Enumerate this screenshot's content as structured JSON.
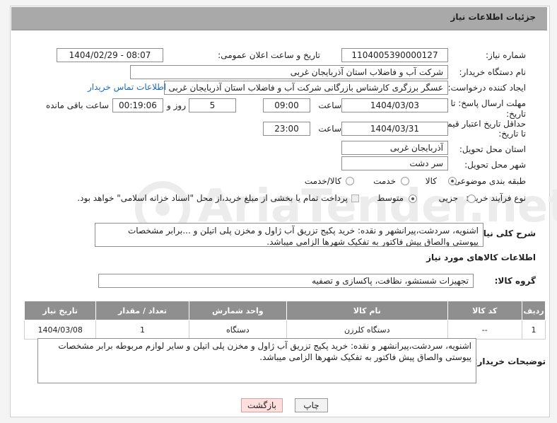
{
  "header": {
    "title": "جزئیات اطلاعات نیاز"
  },
  "watermark": "AriaTender.net",
  "fields": {
    "need_number": {
      "label": "شماره نیاز:",
      "value": "1104005390000127"
    },
    "announce_datetime": {
      "label": "تاریخ و ساعت اعلان عمومی:",
      "value": "1404/02/29 - 08:07"
    },
    "buyer_org": {
      "label": "نام دستگاه خریدار:",
      "value": "شرکت آب و فاضلاب استان آذربایجان غربی"
    },
    "requester": {
      "label": "ایجاد کننده درخواست:",
      "value": "عسگر  برزگری کارشناس بازرگانی شرکت آب و فاضلاب استان آذربایجان غربی",
      "contact_link": "اطلاعات تماس خریدار"
    },
    "send_deadline": {
      "label_line1": "مهلت ارسال پاسخ: تا",
      "label_line2": "تاریخ:",
      "date": "1404/03/03",
      "time_label": "ساعت",
      "time": "09:00",
      "days": "5",
      "days_label": "روز و",
      "remaining": "00:19:06",
      "remaining_label": "ساعت باقی مانده"
    },
    "price_validity": {
      "label_line1": "حداقل تاریخ اعتبار قیمت:",
      "label_line2": "تا تاریخ:",
      "date": "1404/03/31",
      "time_label": "ساعت",
      "time": "23:00"
    },
    "delivery_province": {
      "label": "استان محل تحویل:",
      "value": "آذربایجان غربی"
    },
    "delivery_city": {
      "label": "شهر محل تحویل:",
      "value": "سر دشت"
    },
    "category": {
      "label": "طبقه بندی موضوعی:",
      "options": [
        "کالا",
        "خدمت",
        "کالا/خدمت"
      ],
      "selected": "کالا"
    },
    "process_type": {
      "label": "نوع فرآیند خرید :",
      "options": [
        "جزیی",
        "متوسط"
      ],
      "selected": "متوسط",
      "payment_note": "پرداخت تمام یا بخشی از مبلغ خرید،از محل \"اسناد خزانه اسلامی\" خواهد بود."
    }
  },
  "general_desc": {
    "label": "شرح کلی نیاز:",
    "text": "اشنویه، سردشت،پیرانشهر و نقده: خرید پکیج تزریق آب ژاول و مخزن پلی اتیلن و ...برابر مشخصات پیوستی والصاق پیش فاکتور به تفکیک شهرها الزامی میباشد."
  },
  "goods_section": {
    "title": "اطلاعات کالاهای مورد نیاز",
    "group_label": "گروه کالا:",
    "group_value": "تجهیزات شستشو، نظافت، پاکسازی و تصفیه"
  },
  "table": {
    "headers": [
      "ردیف",
      "کد کالا",
      "نام کالا",
      "واحد شمارش",
      "تعداد / مقدار",
      "تاریخ نیاز"
    ],
    "rows": [
      [
        "1",
        "--",
        "دستگاه کلرزن",
        "دستگاه",
        "1",
        "1404/03/08"
      ]
    ]
  },
  "buyer_notes": {
    "label": "توضیحات خریدار:",
    "text": "اشنویه، سردشت،پیرانشهر و نقده: خرید پکیج تزریق آب ژاول و مخزن پلی اتیلن و سایر لوازم مربوطه برابر مشخصات پیوستی والصاق پیش فاکتور به تفکیک شهرها الزامی میباشد."
  },
  "buttons": {
    "print": "چاپ",
    "back": "بازگشت"
  }
}
